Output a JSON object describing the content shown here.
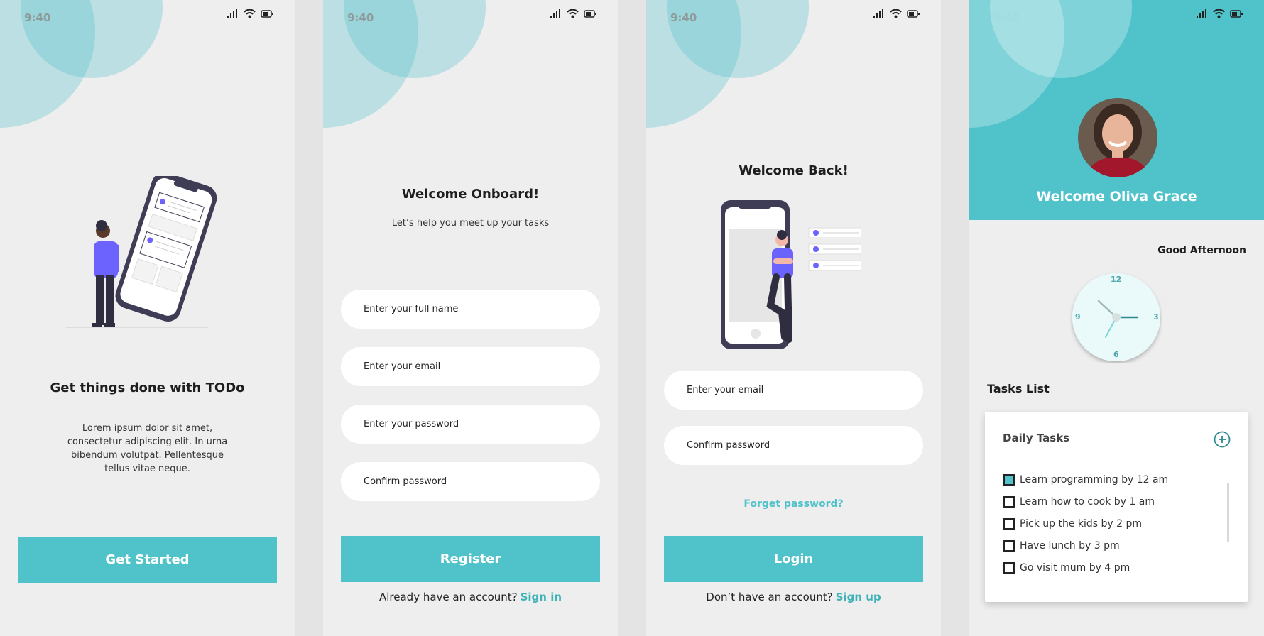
{
  "colors": {
    "accent": "#50c2c9",
    "background": "#eeeeee",
    "illustration_purple": "#6c63ff"
  },
  "status_bar": {
    "time": "9:40",
    "icons": [
      "signal-icon",
      "wifi-icon",
      "battery-icon"
    ]
  },
  "onboarding": {
    "title": "Get things done with TODo",
    "body": "Lorem ipsum dolor sit amet, consectetur adipiscing elit. In urna bibendum volutpat. Pellentesque tellus vitae neque.",
    "button": "Get Started"
  },
  "register": {
    "title": "Welcome Onboard!",
    "subtitle": "Let’s help you meet up your tasks",
    "fields": {
      "full_name": "Enter your full name",
      "email": "Enter your email",
      "password": "Enter your password",
      "confirm": "Confirm password"
    },
    "button": "Register",
    "footer_text": "Already have an account?",
    "footer_link": "Sign in"
  },
  "login": {
    "title": "Welcome Back!",
    "fields": {
      "email": "Enter your email",
      "confirm": "Confirm password"
    },
    "forget": "Forget password?",
    "button": "Login",
    "footer_text": "Don’t have an account?",
    "footer_link": "Sign up"
  },
  "dashboard": {
    "welcome": "Welcome Oliva Grace",
    "greeting": "Good Afternoon",
    "clock": {
      "labels": [
        "12",
        "3",
        "6",
        "9"
      ]
    },
    "tasks_title": "Tasks List",
    "card_title": "Daily Tasks",
    "tasks": [
      {
        "label": "Learn programming by 12 am",
        "done": true
      },
      {
        "label": "Learn how to cook by 1 am",
        "done": false
      },
      {
        "label": "Pick up the kids by 2 pm",
        "done": false
      },
      {
        "label": "Have lunch by 3 pm",
        "done": false
      },
      {
        "label": "Go visit mum by 4 pm",
        "done": false
      }
    ]
  }
}
